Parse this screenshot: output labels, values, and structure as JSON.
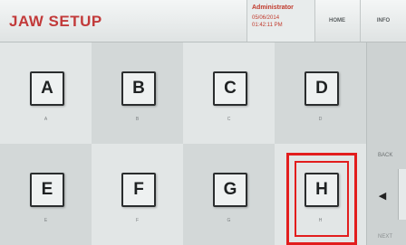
{
  "header": {
    "title": "JAW SETUP",
    "user": {
      "name": "Administrator",
      "date": "05/06/2014",
      "time": "01:42:11 PM"
    },
    "home_label": "HOME",
    "info_label": "INFO"
  },
  "jaws": [
    {
      "letter": "A",
      "sub": "A"
    },
    {
      "letter": "B",
      "sub": "B"
    },
    {
      "letter": "C",
      "sub": "C"
    },
    {
      "letter": "D",
      "sub": "D"
    },
    {
      "letter": "E",
      "sub": "E"
    },
    {
      "letter": "F",
      "sub": "F"
    },
    {
      "letter": "G",
      "sub": "G"
    },
    {
      "letter": "H",
      "sub": "H"
    }
  ],
  "selected": "H",
  "nav": {
    "back_label": "BACK",
    "next_label": "NEXT",
    "arrow_icon": "triangle-left-icon"
  },
  "colors": {
    "title": "#c23a3a",
    "highlight": "#e21d1d"
  }
}
